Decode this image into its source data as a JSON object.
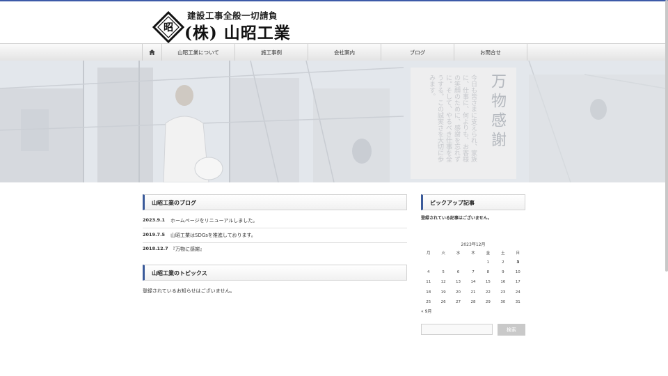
{
  "header": {
    "tagline": "建設工事全般一切請負",
    "company_name": "(株) 山昭工業",
    "logo_mark_char": "昭"
  },
  "nav": {
    "home_icon": "home-icon",
    "items": [
      {
        "label": "山昭工業について"
      },
      {
        "label": "施工事例"
      },
      {
        "label": "会社案内"
      },
      {
        "label": "ブログ"
      },
      {
        "label": "お問合せ"
      }
    ]
  },
  "hero": {
    "sign_title": "万物感謝",
    "sign_poem": "今日も皆さまに支えられ、家族に、仕事に、何よりも、お客様の笑顔のために、感謝を忘れずに。そして、やるべき仕事を全うする。この誠実さを大切に歩みます。"
  },
  "blog": {
    "heading": "山昭工業のブログ",
    "posts": [
      {
        "date": "2023.9.1",
        "title": "ホームページをリニューアルしました。"
      },
      {
        "date": "2019.7.5",
        "title": "山昭工業はSDGsを推進しております。"
      },
      {
        "date": "2018.12.7",
        "title": "『万物に感謝』"
      }
    ]
  },
  "topics": {
    "heading": "山昭工業のトピックス",
    "empty_text": "登録されているお知らせはございません。"
  },
  "pickup": {
    "heading": "ピックアップ記事",
    "empty_text": "登録されている記事はございません。"
  },
  "calendar": {
    "caption": "2023年12月",
    "weekdays": [
      "月",
      "火",
      "水",
      "木",
      "金",
      "土",
      "日"
    ],
    "weeks": [
      [
        "",
        "",
        "",
        "",
        "1",
        "2",
        "3"
      ],
      [
        "4",
        "5",
        "6",
        "7",
        "8",
        "9",
        "10"
      ],
      [
        "11",
        "12",
        "13",
        "14",
        "15",
        "16",
        "17"
      ],
      [
        "18",
        "19",
        "20",
        "21",
        "22",
        "23",
        "24"
      ],
      [
        "25",
        "26",
        "27",
        "28",
        "29",
        "30",
        "31"
      ]
    ],
    "today": "3",
    "prev_link": "« 9月"
  },
  "search": {
    "placeholder": "",
    "button_label": "検索"
  },
  "colors": {
    "accent": "#3a5a9a",
    "top_line": "#3c5aa8"
  }
}
